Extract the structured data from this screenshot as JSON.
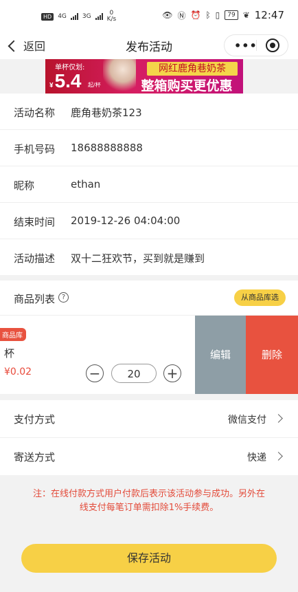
{
  "status_bar": {
    "left_badge": "HD",
    "net1": "4G",
    "net2": "3G",
    "speed_value": "0",
    "speed_unit": "K/s",
    "battery": "79",
    "time": "12:47"
  },
  "navbar": {
    "back_label": "返回",
    "title": "发布活动"
  },
  "banner": {
    "tag": "单杯仅划:",
    "currency": "¥",
    "price": "5.4",
    "unit": "起/杯",
    "line1": "网红鹿角巷奶茶",
    "line2": "整箱购买更优惠"
  },
  "form": {
    "rows": [
      {
        "label": "活动名称",
        "value": "鹿角巷奶茶123"
      },
      {
        "label": "手机号码",
        "value": "18688888888"
      },
      {
        "label": "昵称",
        "value": "ethan"
      },
      {
        "label": "结束时间",
        "value": "2019-12-26 04:04:00"
      },
      {
        "label": "活动描述",
        "value": "双十二狂欢节，买到就是赚到"
      }
    ]
  },
  "goods": {
    "header_label": "商品列表",
    "help_glyph": "?",
    "library_button": "从商品库选",
    "item": {
      "tag": "商品库",
      "name": "杯",
      "price": "¥0.02",
      "minus": "−",
      "quantity": "20",
      "plus": "+",
      "edit": "编辑",
      "delete": "删除"
    }
  },
  "payment": {
    "label": "支付方式",
    "value": "微信支付"
  },
  "shipping": {
    "label": "寄送方式",
    "value": "快递"
  },
  "notice": "注：在线付款方式用户付款后表示该活动参与成功。另外在线支付每笔订单需扣除1%手续费。",
  "save_button": "保存活动"
}
